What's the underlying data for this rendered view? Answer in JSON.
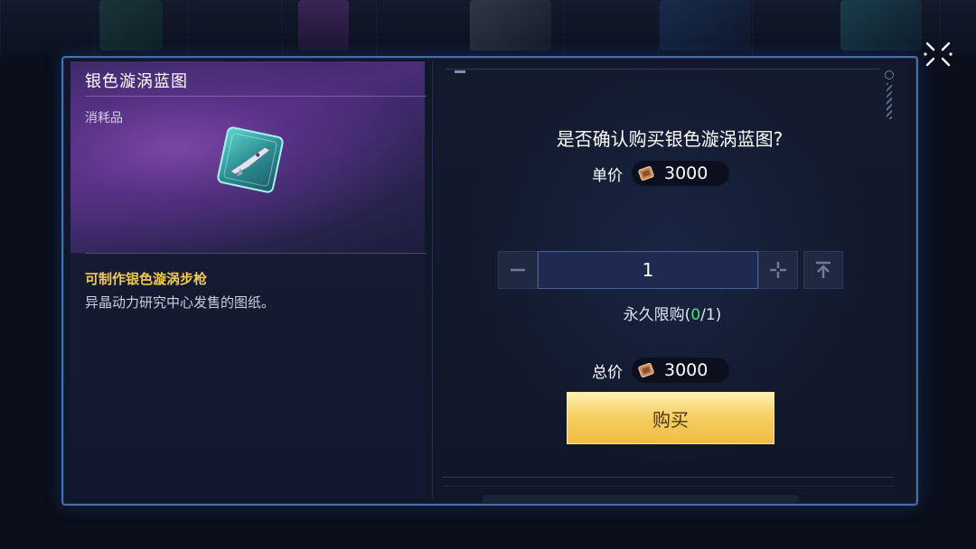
{
  "item": {
    "name": "银色漩涡蓝图",
    "type": "消耗品",
    "craft_note": "可制作银色漩涡步枪",
    "description": "异晶动力研究中心发售的图纸。"
  },
  "purchase": {
    "confirm_text": "是否确认购买银色漩涡蓝图?",
    "unit_price_label": "单价",
    "unit_price": "3000",
    "quantity": "1",
    "limit_prefix": "永久限购(",
    "limit_bought": "0",
    "limit_suffix": "/1)",
    "total_label": "总价",
    "total_price": "3000",
    "buy_label": "购买"
  },
  "icons": {
    "close": "close-icon",
    "coin": "coin-icon",
    "minus": "minus-icon",
    "plus": "plus-icon",
    "max": "max-icon",
    "blueprint": "blueprint-icon"
  },
  "colors": {
    "accent_frame": "#3f6fb5",
    "highlight_yellow": "#f2c94c",
    "limit_green": "#4fe07a",
    "buy_gold": "#f0bd45"
  }
}
